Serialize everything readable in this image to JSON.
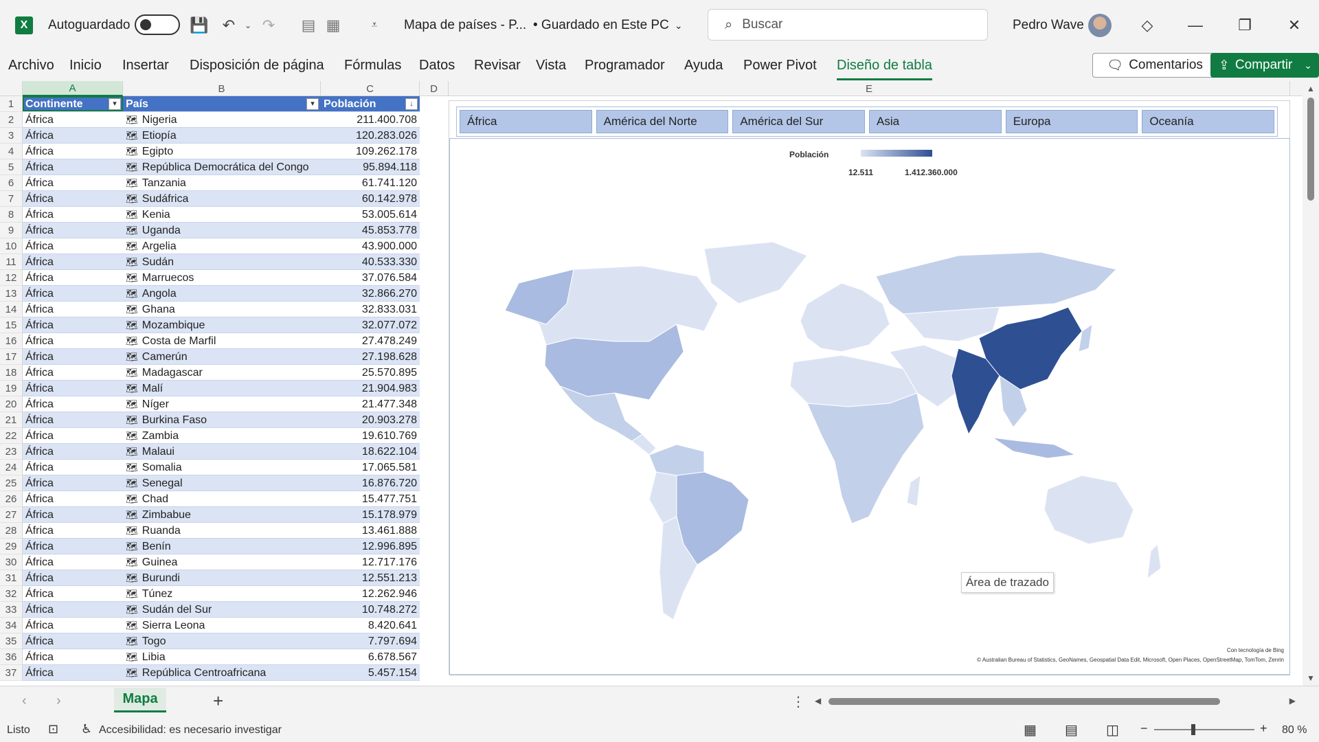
{
  "titlebar": {
    "autosave_label": "Autoguardado",
    "doc_title": "Mapa de países - P...",
    "saved_status": "• Guardado en Este PC",
    "search_placeholder": "Buscar",
    "user_name": "Pedro Wave"
  },
  "ribbon": {
    "tabs": [
      "Archivo",
      "Inicio",
      "Insertar",
      "Disposición de página",
      "Fórmulas",
      "Datos",
      "Revisar",
      "Vista",
      "Programador",
      "Ayuda",
      "Power Pivot",
      "Diseño de tabla"
    ],
    "comments_label": "Comentarios",
    "share_label": "Compartir"
  },
  "grid": {
    "columns": [
      "A",
      "B",
      "C",
      "D",
      "E"
    ],
    "headers": [
      "Continente",
      "País",
      "Población"
    ],
    "rows": [
      [
        "África",
        "Nigeria",
        "211.400.708"
      ],
      [
        "África",
        "Etiopía",
        "120.283.026"
      ],
      [
        "África",
        "Egipto",
        "109.262.178"
      ],
      [
        "África",
        "República Democrática del Congo",
        "95.894.118"
      ],
      [
        "África",
        "Tanzania",
        "61.741.120"
      ],
      [
        "África",
        "Sudáfrica",
        "60.142.978"
      ],
      [
        "África",
        "Kenia",
        "53.005.614"
      ],
      [
        "África",
        "Uganda",
        "45.853.778"
      ],
      [
        "África",
        "Argelia",
        "43.900.000"
      ],
      [
        "África",
        "Sudán",
        "40.533.330"
      ],
      [
        "África",
        "Marruecos",
        "37.076.584"
      ],
      [
        "África",
        "Angola",
        "32.866.270"
      ],
      [
        "África",
        "Ghana",
        "32.833.031"
      ],
      [
        "África",
        "Mozambique",
        "32.077.072"
      ],
      [
        "África",
        "Costa de Marfil",
        "27.478.249"
      ],
      [
        "África",
        "Camerún",
        "27.198.628"
      ],
      [
        "África",
        "Madagascar",
        "25.570.895"
      ],
      [
        "África",
        "Malí",
        "21.904.983"
      ],
      [
        "África",
        "Níger",
        "21.477.348"
      ],
      [
        "África",
        "Burkina Faso",
        "20.903.278"
      ],
      [
        "África",
        "Zambia",
        "19.610.769"
      ],
      [
        "África",
        "Malaui",
        "18.622.104"
      ],
      [
        "África",
        "Somalia",
        "17.065.581"
      ],
      [
        "África",
        "Senegal",
        "16.876.720"
      ],
      [
        "África",
        "Chad",
        "15.477.751"
      ],
      [
        "África",
        "Zimbabue",
        "15.178.979"
      ],
      [
        "África",
        "Ruanda",
        "13.461.888"
      ],
      [
        "África",
        "Benín",
        "12.996.895"
      ],
      [
        "África",
        "Guinea",
        "12.717.176"
      ],
      [
        "África",
        "Burundi",
        "12.551.213"
      ],
      [
        "África",
        "Túnez",
        "12.262.946"
      ],
      [
        "África",
        "Sudán del Sur",
        "10.748.272"
      ],
      [
        "África",
        "Sierra Leona",
        "8.420.641"
      ],
      [
        "África",
        "Togo",
        "7.797.694"
      ],
      [
        "África",
        "Libia",
        "6.678.567"
      ],
      [
        "África",
        "República Centroafricana",
        "5.457.154"
      ]
    ]
  },
  "chart": {
    "slicer_items": [
      "África",
      "América del Norte",
      "América del Sur",
      "Asia",
      "Europa",
      "Oceanía"
    ],
    "legend_title": "Población",
    "legend_min": "12.511",
    "legend_max": "1.412.360.000",
    "tooltip": "Área de trazado",
    "bing_credit": "Con tecnología de Bing",
    "attribution": "© Australian Bureau of Statistics, GeoNames, Geospatial Data Edit, Microsoft, Open Places, OpenStreetMap, TomTom, Zenrin",
    "colors": {
      "low": "#dbe3f3",
      "mid": "#a9bbe0",
      "high": "#2f4f93"
    }
  },
  "sheets": {
    "active": "Mapa"
  },
  "status": {
    "ready": "Listo",
    "accessibility": "Accesibilidad: es necesario investigar",
    "zoom": "80 %"
  }
}
